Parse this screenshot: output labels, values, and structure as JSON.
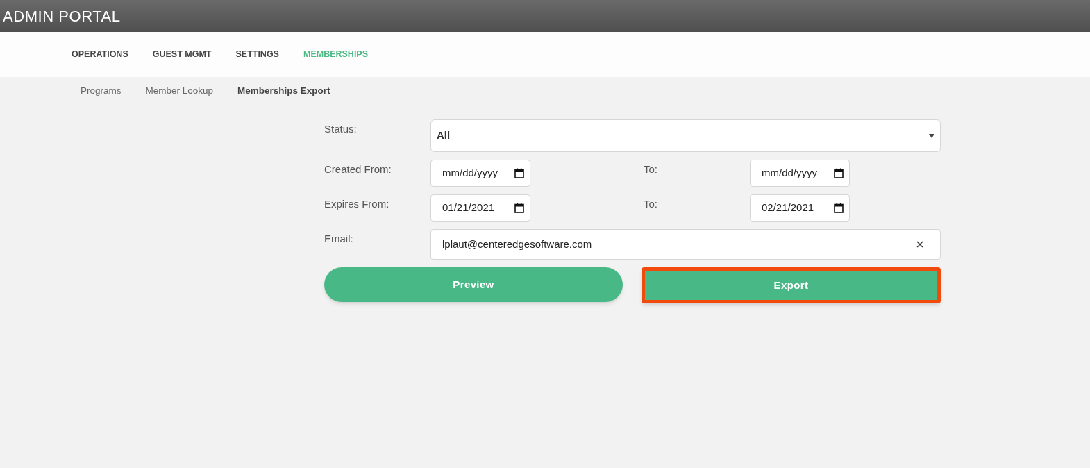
{
  "header": {
    "title": "ADMIN PORTAL"
  },
  "nav": [
    {
      "label": "OPERATIONS",
      "selected": false
    },
    {
      "label": "GUEST MGMT",
      "selected": false
    },
    {
      "label": "SETTINGS",
      "selected": false
    },
    {
      "label": "MEMBERSHIPS",
      "selected": true
    }
  ],
  "subnav": [
    {
      "label": "Programs",
      "selected": false
    },
    {
      "label": "Member Lookup",
      "selected": false
    },
    {
      "label": "Memberships Export",
      "selected": true
    }
  ],
  "form": {
    "status": {
      "label": "Status:",
      "value": "All"
    },
    "created": {
      "from_label": "Created From:",
      "from_placeholder": "mm/dd/yyyy",
      "to_label": "To:",
      "to_placeholder": "mm/dd/yyyy"
    },
    "expires": {
      "from_label": "Expires From:",
      "from_value": "01/21/2021",
      "to_label": "To:",
      "to_value": "02/21/2021"
    },
    "email": {
      "label": "Email:",
      "value": "lplaut@centeredgesoftware.com"
    }
  },
  "buttons": [
    {
      "label": "Preview",
      "highlighted": false
    },
    {
      "label": "Export",
      "highlighted": true
    }
  ]
}
